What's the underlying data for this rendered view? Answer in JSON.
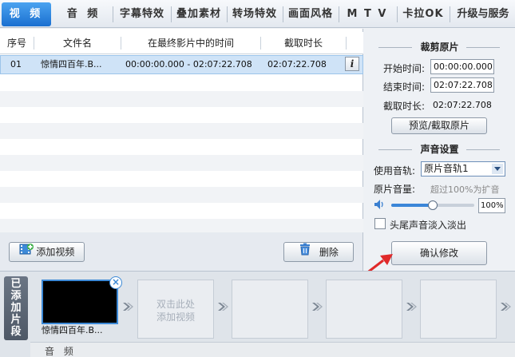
{
  "tabs": [
    {
      "label": "视 频",
      "active": true
    },
    {
      "label": "音 频"
    },
    {
      "label": "字幕特效"
    },
    {
      "label": "叠加素材"
    },
    {
      "label": "转场特效"
    },
    {
      "label": "画面风格"
    },
    {
      "label": "M T V"
    },
    {
      "label": "卡拉OK"
    },
    {
      "label": "升级与服务"
    }
  ],
  "table": {
    "headers": [
      "序号",
      "文件名",
      "在最终影片中的时间",
      "截取时长"
    ],
    "rows": [
      {
        "index": "01",
        "name": "惊情四百年.B...",
        "time_range": "00:00:00.000 - 02:07:22.708",
        "duration": "02:07:22.708",
        "info": "i"
      }
    ]
  },
  "actions": {
    "add_video": "添加视频",
    "delete": "删除"
  },
  "trim": {
    "title": "裁剪原片",
    "start_label": "开始时间:",
    "start_value": "00:00:00.000",
    "end_label": "结束时间:",
    "end_value": "02:07:22.708",
    "duration_label": "截取时长:",
    "duration_value": "02:07:22.708",
    "preview_button": "预览/截取原片"
  },
  "sound": {
    "title": "声音设置",
    "track_label": "使用音轨:",
    "track_value": "原片音轨1",
    "volume_label": "原片音量:",
    "volume_hint": "超过100%为扩音",
    "volume_value": "100%",
    "volume_level": 0.5,
    "fade_label": "头尾声音淡入淡出",
    "fade_checked": false
  },
  "confirm_button": "确认修改",
  "strip": {
    "label": "已添加片段",
    "clips": [
      {
        "name": "惊情四百年.B..."
      },
      {
        "placeholder_line1": "双击此处",
        "placeholder_line2": "添加视频"
      }
    ],
    "audio_label": "音 频"
  },
  "colors": {
    "accent": "#1a6fd0",
    "selection": "#cfe3f7",
    "annotation_arrow": "#e02a2a"
  }
}
